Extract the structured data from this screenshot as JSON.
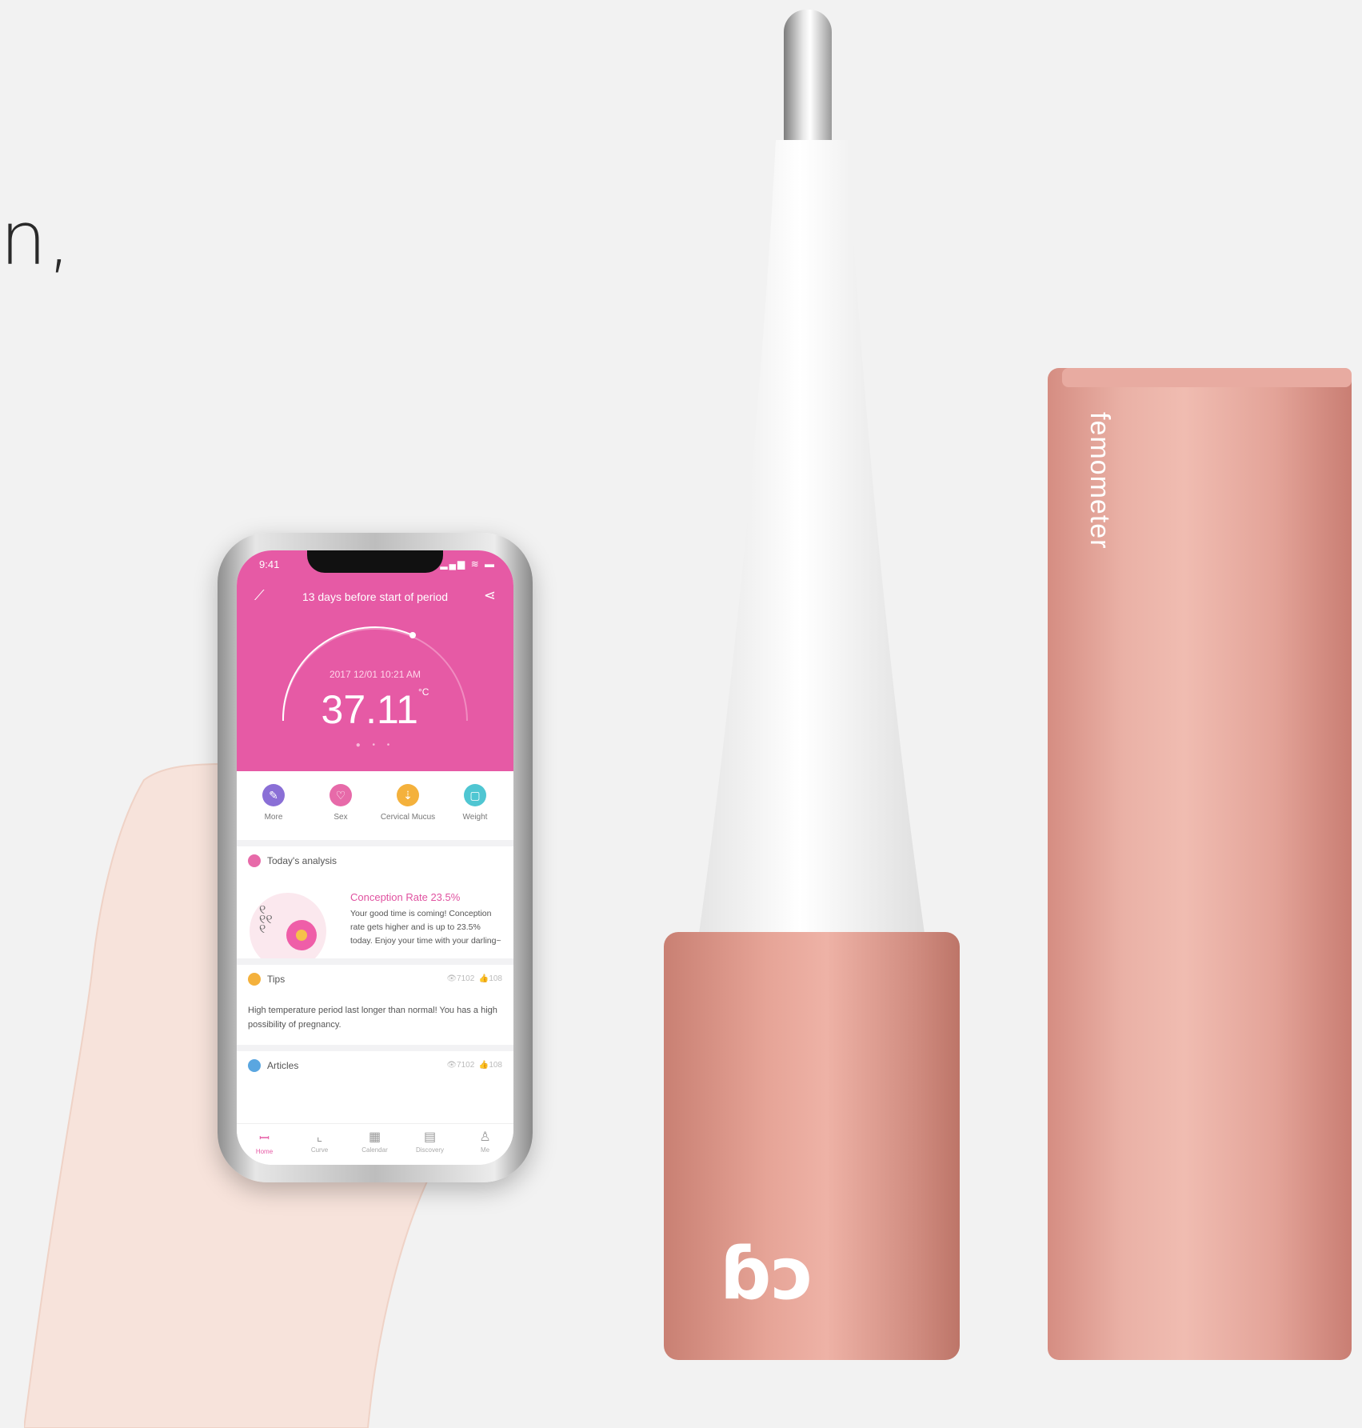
{
  "fragment_text": "n,",
  "app": {
    "status_time": "9:41",
    "status_icons": "▂▄▆ ≋ ▬",
    "header_title": "13 days before start of period",
    "measure_datetime": "2017 12/01 10:21 AM",
    "temperature": "37.11",
    "temperature_unit": "°C",
    "quick_actions": [
      {
        "label": "More",
        "icon": "note-icon",
        "color": "#8a6fd6"
      },
      {
        "label": "Sex",
        "icon": "heart-icon",
        "color": "#e76aa9"
      },
      {
        "label": "Cervical Mucus",
        "icon": "drop-icon",
        "color": "#f4b13c"
      },
      {
        "label": "Weight",
        "icon": "scale-icon",
        "color": "#4fc6d2"
      }
    ],
    "analysis": {
      "heading": "Today's analysis",
      "title": "Conception Rate  23.5%",
      "body": "Your good time is coming! Conception rate gets higher and is up to 23.5% today. Enjoy your time with your darling~"
    },
    "tips": {
      "heading": "Tips",
      "views": "7102",
      "likes": "108",
      "body": "High temperature period last longer than normal!  You has a high possibility of pregnancy."
    },
    "articles": {
      "heading": "Articles",
      "views": "7102",
      "likes": "108"
    },
    "tabs": [
      {
        "label": "Home",
        "icon": "home-icon",
        "glyph": "ꟷ"
      },
      {
        "label": "Curve",
        "icon": "chart-icon",
        "glyph": "⌞"
      },
      {
        "label": "Calendar",
        "icon": "calendar-icon",
        "glyph": "▦"
      },
      {
        "label": "Discovery",
        "icon": "discovery-icon",
        "glyph": "▤"
      },
      {
        "label": "Me",
        "icon": "user-icon",
        "glyph": "♙"
      }
    ]
  },
  "product": {
    "brand_text": "femometer",
    "logo_text": "ɓɔ"
  },
  "colors": {
    "app_pink": "#e65aa5",
    "rose_gold": "#e6a497",
    "background": "#f2f2f2"
  }
}
